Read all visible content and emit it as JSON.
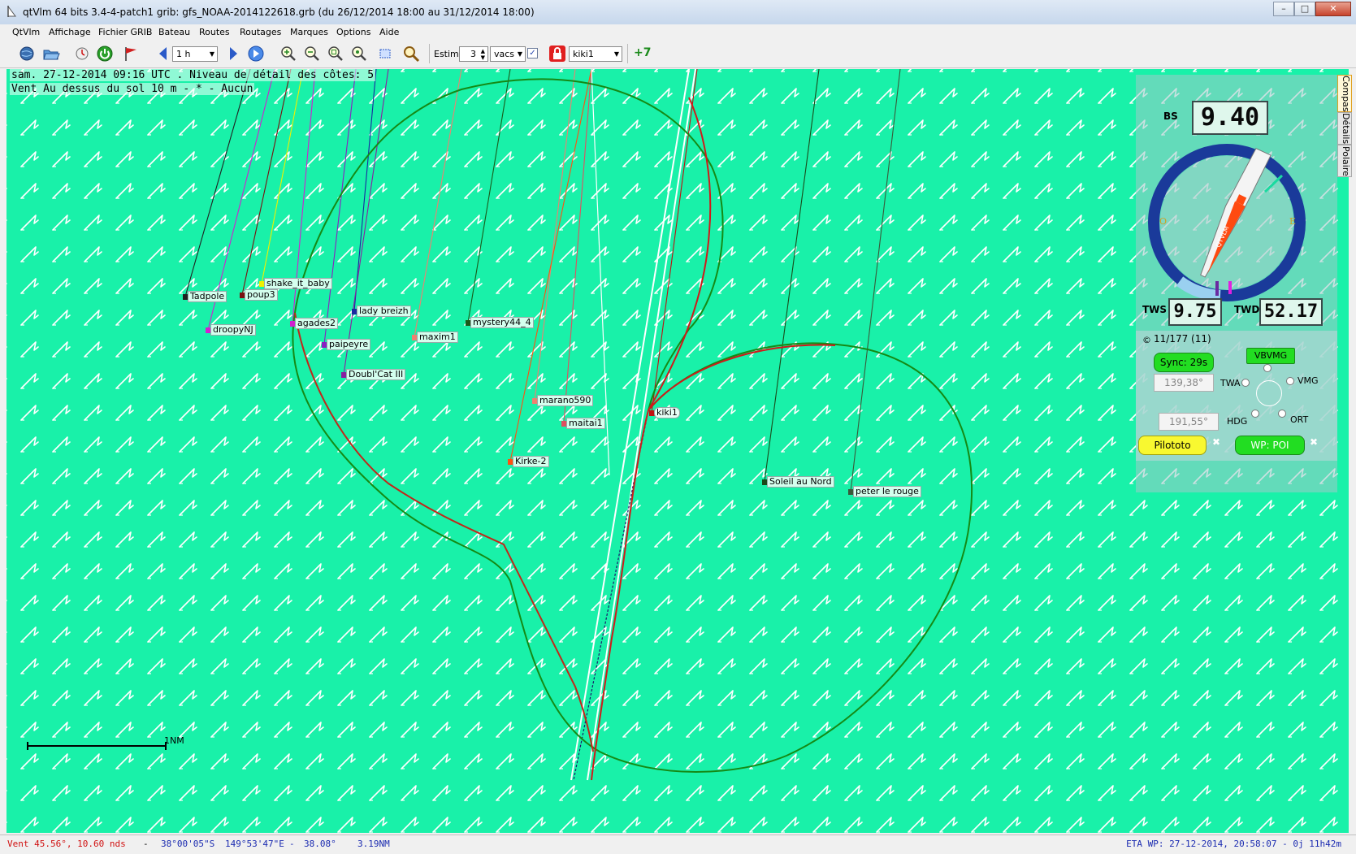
{
  "window": {
    "title": "qtVlm 64 bits 3.4-4-patch1 grib: gfs_NOAA-2014122618.grb (du 26/12/2014 18:00 au 31/12/2014 18:00)"
  },
  "menu": [
    "QtVlm",
    "Affichage",
    "Fichier GRIB",
    "Bateau",
    "Routes",
    "Routages",
    "Marques",
    "Options",
    "Aide"
  ],
  "toolbar": {
    "time_step": "1 h",
    "estime_label": "Estime",
    "estime_value": "3",
    "estime_unit": "vacs",
    "boat_select": "kiki1",
    "waypoint_btn_label": "+7"
  },
  "map": {
    "info_line_1": "sam. 27-12-2014 09:16 UTC . Niveau de détail des côtes: 5",
    "info_line_2": "Vent Au dessus du sol 10 m - * - Aucun",
    "scale_label": "1NM",
    "background": "#19f1a9"
  },
  "boats": [
    {
      "name": "Tadpole",
      "color": "#202020"
    },
    {
      "name": "poup3",
      "color": "#7a1010"
    },
    {
      "name": "shake_it_baby",
      "color": "#f0f000"
    },
    {
      "name": "droopyNJ",
      "color": "#d020d0"
    },
    {
      "name": "agades2",
      "color": "#d020d0"
    },
    {
      "name": "lady breizh",
      "color": "#1a2aa0"
    },
    {
      "name": "paipeyre",
      "color": "#8a20c0"
    },
    {
      "name": "maxim1",
      "color": "#f08070"
    },
    {
      "name": "mystery44_4",
      "color": "#1a5a1a"
    },
    {
      "name": "Doubl'Cat III",
      "color": "#8a20a0"
    },
    {
      "name": "marano590",
      "color": "#f08070"
    },
    {
      "name": "maitai1",
      "color": "#e05060"
    },
    {
      "name": "Kirke-2",
      "color": "#ff5010"
    },
    {
      "name": "kiki1",
      "color": "#c01010"
    },
    {
      "name": "Soleil au Nord",
      "color": "#1a4a1a"
    },
    {
      "name": "peter le rouge",
      "color": "#3a5a3a"
    }
  ],
  "panel": {
    "tabs": [
      "Compas",
      "Détails",
      "Polaire"
    ],
    "bs_label": "BS",
    "bs_value": "9.40",
    "tws_label": "TWS",
    "tws_value": "9.75",
    "twd_label": "TWD",
    "twd_value": "52.17",
    "vac_info": "11/177 (11)",
    "sync_label": "Sync: 29s",
    "vbvmg_label": "VBVMG",
    "twa_value": "139,38°",
    "twa_label": "TWA",
    "vmg_label": "VMG",
    "hdg_value": "191,55°",
    "hdg_label": "HDG",
    "ort_label": "ORT",
    "pilototo_label": "Pilototo",
    "wp_label": "WP: POI",
    "compass_letter_w": "O",
    "compass_letter_e": "E",
    "boat_brand": "QTVLM"
  },
  "status": {
    "wind": "Vent  45.56°,  10.60 nds",
    "dash": "-",
    "lat": "38°00'05\"S",
    "lon": "149°53'47\"E",
    "sep2": "-",
    "heading": "38.08°",
    "distance": "3.19NM",
    "eta": "ETA WP: 27-12-2014, 20:58:07 - 0j 11h42m"
  }
}
